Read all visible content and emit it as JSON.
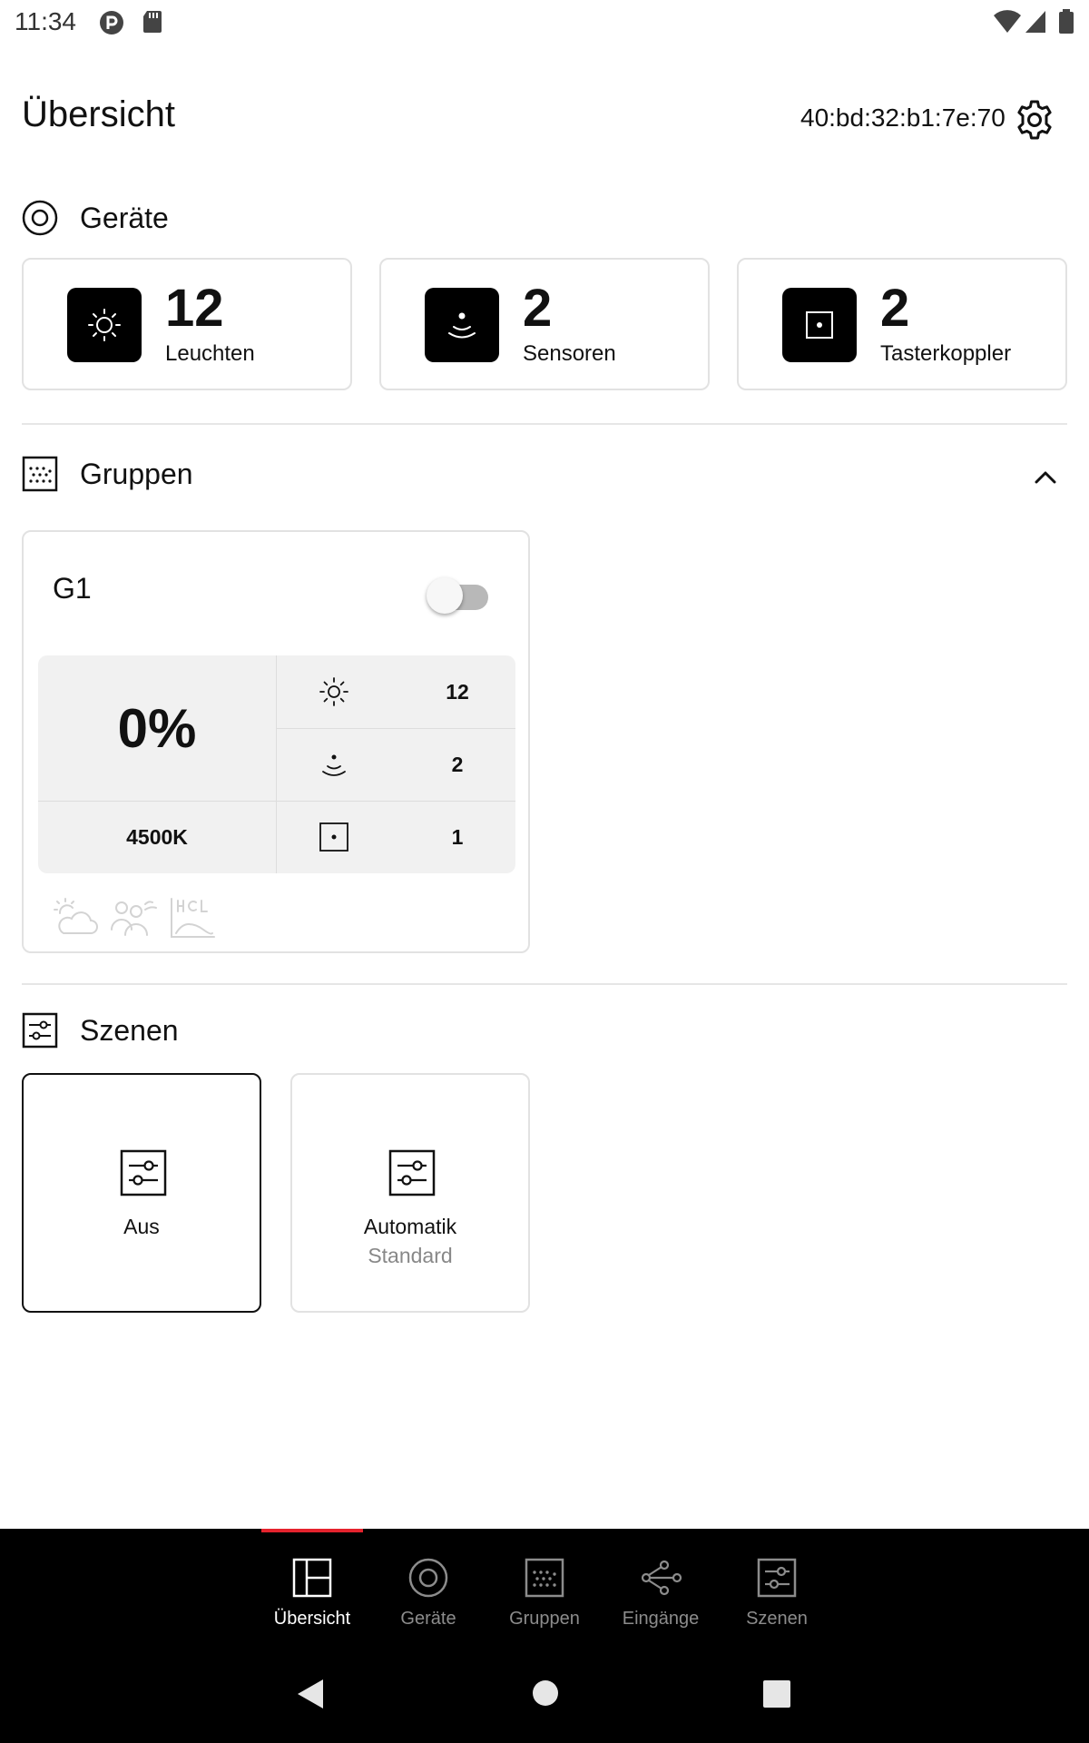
{
  "status_bar": {
    "time": "11:34"
  },
  "header": {
    "title": "Übersicht",
    "device_id": "40:bd:32:b1:7e:70"
  },
  "devices_section": {
    "title": "Geräte",
    "cards": [
      {
        "count": "12",
        "label": "Leuchten",
        "icon": "sun-icon"
      },
      {
        "count": "2",
        "label": "Sensoren",
        "icon": "sensor-icon"
      },
      {
        "count": "2",
        "label": "Tasterkoppler",
        "icon": "push-button-coupler-icon"
      }
    ]
  },
  "groups_section": {
    "title": "Gruppen",
    "expanded": true,
    "groups": [
      {
        "name": "G1",
        "on": false,
        "brightness": "0%",
        "color_temperature": "4500K",
        "luminaires": "12",
        "sensors": "2",
        "couplers": "1",
        "feature_icons": [
          "daylight-icon",
          "presence-icon",
          "hcl-icon"
        ]
      }
    ]
  },
  "scenes_section": {
    "title": "Szenen",
    "scenes": [
      {
        "name": "Aus",
        "subtitle": "",
        "active": true
      },
      {
        "name": "Automatik",
        "subtitle": "Standard",
        "active": false
      }
    ]
  },
  "bottom_nav": {
    "active_index": 0,
    "accent_color": "#e5232d",
    "items": [
      {
        "label": "Übersicht",
        "icon": "overview-icon"
      },
      {
        "label": "Geräte",
        "icon": "devices-icon"
      },
      {
        "label": "Gruppen",
        "icon": "groups-icon"
      },
      {
        "label": "Eingänge",
        "icon": "inputs-icon"
      },
      {
        "label": "Szenen",
        "icon": "scenes-icon"
      }
    ]
  }
}
